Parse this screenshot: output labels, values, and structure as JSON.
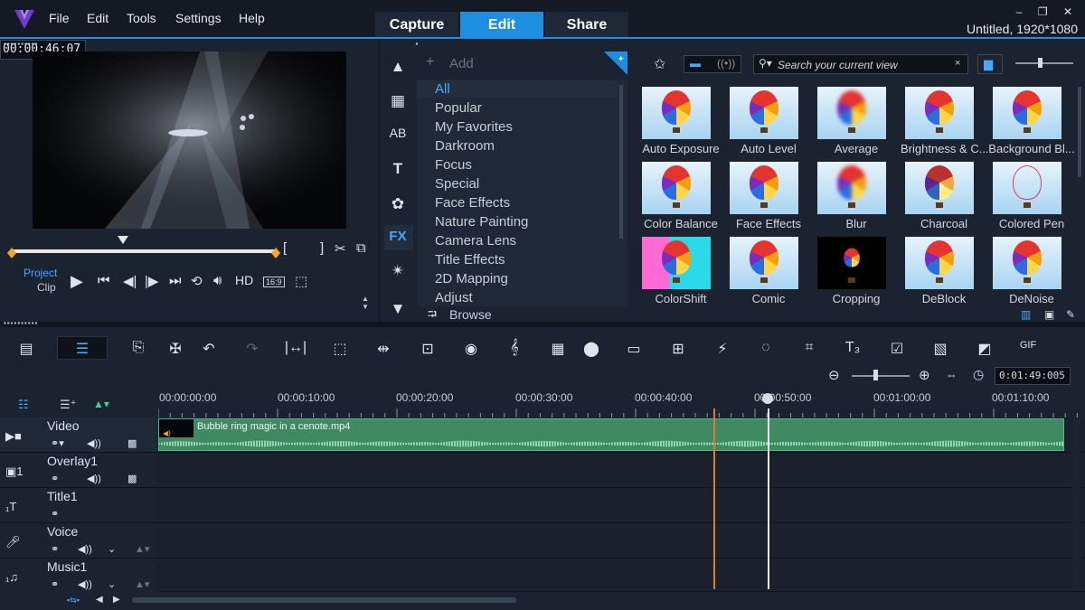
{
  "menu": [
    "File",
    "Edit",
    "Tools",
    "Settings",
    "Help"
  ],
  "tabs": {
    "capture": "Capture",
    "edit": "Edit",
    "share": "Share"
  },
  "window": {
    "project_info": "Untitled, 1920*1080",
    "minimize": "–",
    "restore": "❐",
    "close": "✕"
  },
  "player": {
    "project_label": "Project",
    "clip_label": "Clip",
    "hd_label": "HD",
    "aspect_label": "16:9",
    "timecode": "00:00:46:07",
    "mark_in": "[",
    "mark_out": "]"
  },
  "library": {
    "add_label": "Add",
    "search_placeholder": "Search your current view",
    "fx_label": "FX",
    "browse_label": "Browse",
    "categories": [
      "All",
      "Popular",
      "My Favorites",
      "Darkroom",
      "Focus",
      "Special",
      "Face Effects",
      "Nature Painting",
      "Camera Lens",
      "Title Effects",
      "2D Mapping",
      "Adjust"
    ],
    "selected_category": "All",
    "effects": [
      "Auto Exposure",
      "Auto Level",
      "Average",
      "Brightness & C...",
      "Background Bl...",
      "Color Balance",
      "Face Effects",
      "Blur",
      "Charcoal",
      "Colored Pen",
      "ColorShift",
      "Comic",
      "Cropping",
      "DeBlock",
      "DeNoise"
    ]
  },
  "timeline": {
    "zoom_timecode": "0:01:49:005",
    "ruler": [
      "00:00:00:00",
      "00:00:10:00",
      "00:00:20:00",
      "00:00:30:00",
      "00:00:40:00",
      "00:00:50:00",
      "00:01:00:00",
      "00:01:10:00"
    ],
    "tracks": [
      "Video",
      "Overlay1",
      "Title1",
      "Voice",
      "Music1"
    ],
    "clip_name": "Bubble ring magic in a cenote.mp4"
  },
  "colors": {
    "accent": "#1d8fe0",
    "clip": "#3f8a62",
    "playhead": "#e07a2e"
  }
}
